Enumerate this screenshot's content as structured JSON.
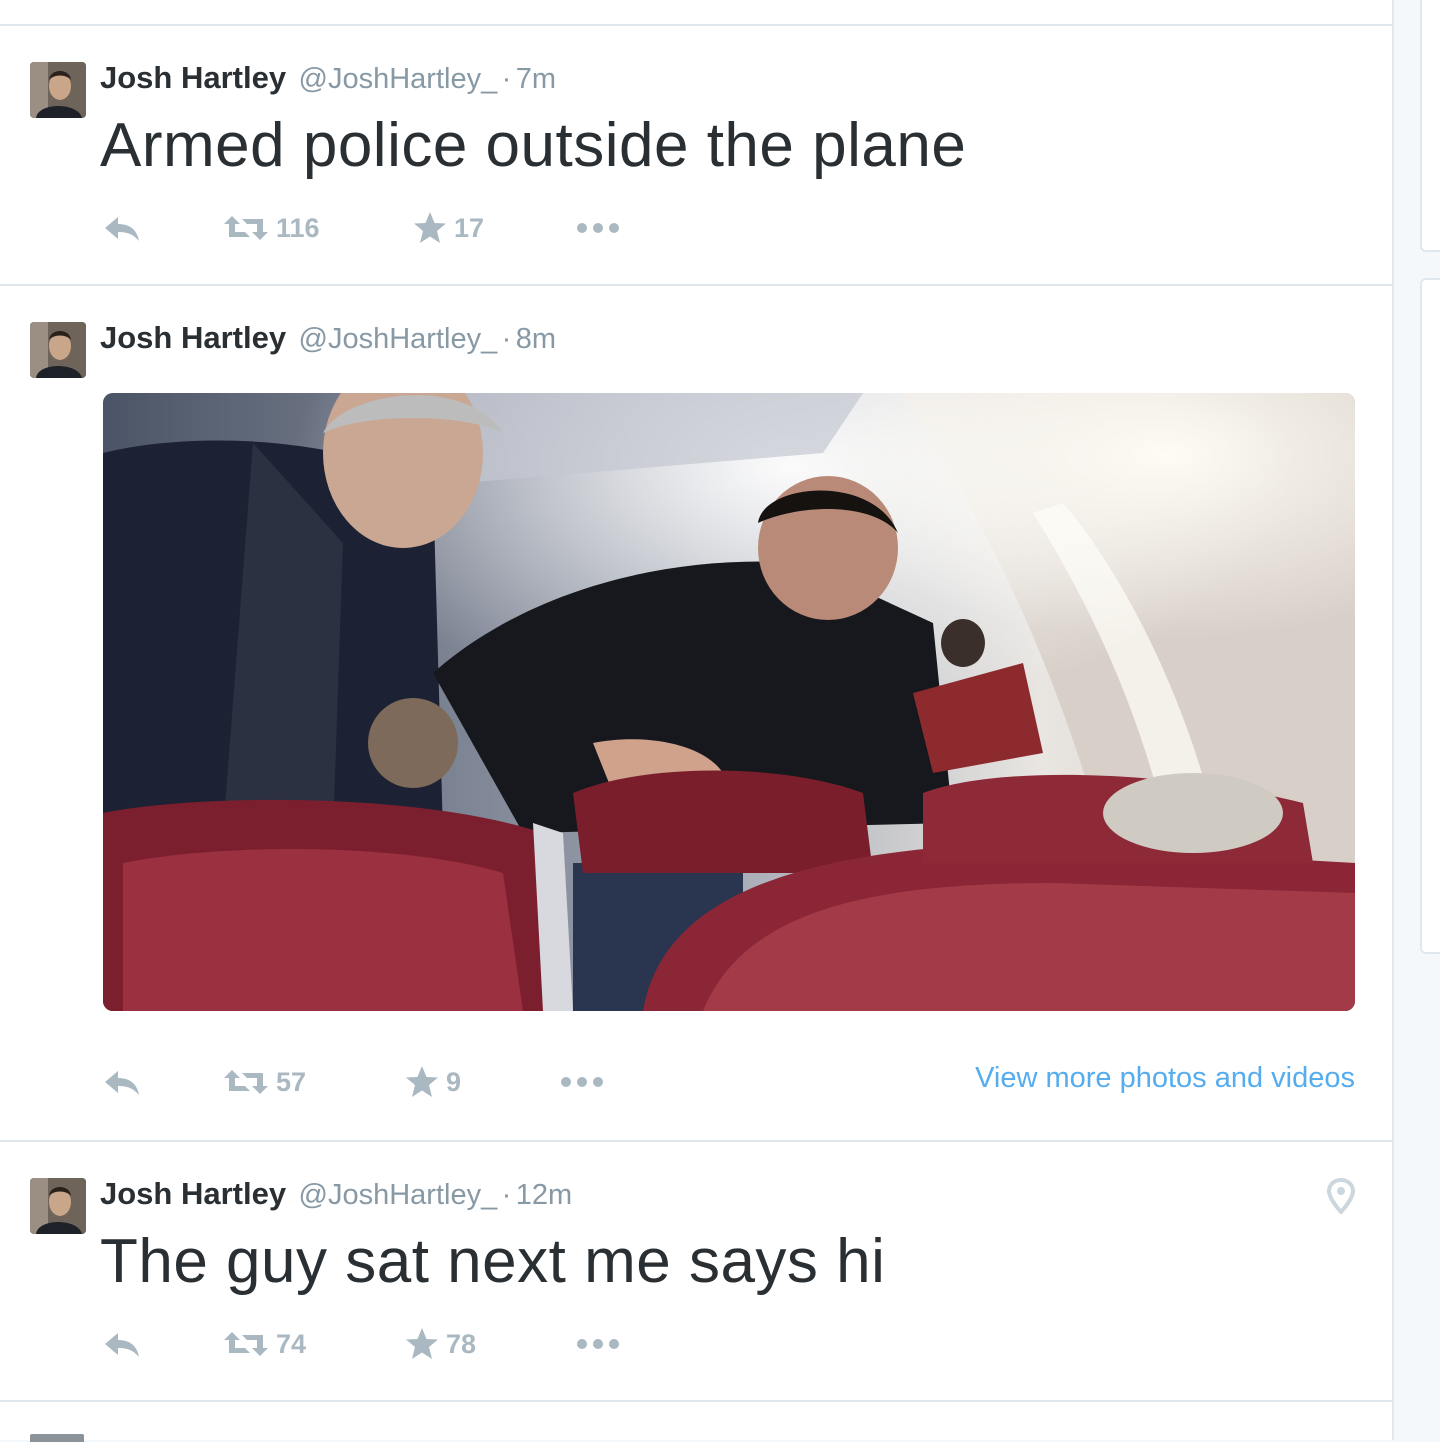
{
  "tweets": [
    {
      "name": "Josh Hartley",
      "handle": "@JoshHartley_",
      "separator": "·",
      "time": "7m",
      "text": "Armed police outside the plane",
      "retweets": "116",
      "favorites": "17"
    },
    {
      "name": "Josh Hartley",
      "handle": "@JoshHartley_",
      "separator": "·",
      "time": "8m",
      "retweets": "57",
      "favorites": "9",
      "media_link": "View more photos and videos"
    },
    {
      "name": "Josh Hartley",
      "handle": "@JoshHartley_",
      "separator": "·",
      "time": "12m",
      "text": "The guy sat next me says hi",
      "retweets": "74",
      "favorites": "78"
    }
  ],
  "icons": {
    "reply": "reply-icon",
    "retweet": "retweet-icon",
    "favorite": "star-icon",
    "more": "more-icon",
    "location": "location-pin-icon"
  },
  "colors": {
    "link": "#55acee",
    "muted": "#aab8c2",
    "border": "#e1e8ed"
  }
}
